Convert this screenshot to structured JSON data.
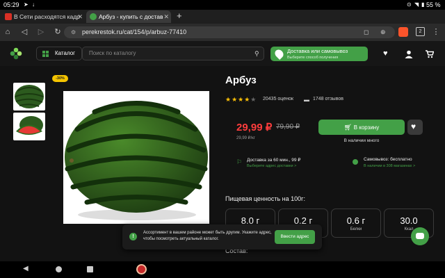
{
  "status_bar": {
    "time": "05:29",
    "battery": "55 %"
  },
  "tabs": [
    {
      "title": "В Сети расходятся кадр",
      "favicon_color": "#d93025"
    },
    {
      "title": "Арбуз - купить с достав",
      "favicon_color": "#43a047"
    }
  ],
  "browser": {
    "url": "perekrestok.ru/cat/154/p/arbuz-77410",
    "tab_count": "2"
  },
  "header": {
    "catalog_label": "Каталог",
    "search_placeholder": "Поиск по каталогу",
    "delivery_title": "Доставка или самовывоз",
    "delivery_subtitle": "Выберите способ получения"
  },
  "product": {
    "badge": "-30%",
    "title": "Арбуз",
    "rating_stars": 4,
    "ratings_count": "20435 оценок",
    "reviews_count": "1748 отзывов",
    "price": "29,99 ₽",
    "old_price": "79,90 ₽",
    "unit_price": "29,99 ₽/кг",
    "cart_button": "В корзину",
    "availability": "В наличии много",
    "delivery_info": "Доставка за 60 мин., 99 ₽",
    "delivery_link": "Выберите адрес доставки >",
    "pickup_info": "Самовывоз: бесплатно",
    "pickup_link": "В наличии в 308 магазинах >",
    "nutrition_title": "Пищевая ценность на 100г:",
    "nutrition": [
      {
        "value": "8.0 г",
        "label": ""
      },
      {
        "value": "0.2 г",
        "label": ""
      },
      {
        "value": "0.6 г",
        "label": "Белки"
      },
      {
        "value": "30.0",
        "label": "Ккал"
      }
    ],
    "composition_label": "Состав:"
  },
  "toast": {
    "text": "Ассортимент в вашем районе может быть другим. Укажите адрес, чтобы посмотреть актуальный каталог.",
    "button": "Ввести адрес"
  },
  "colors": {
    "accent": "#43a047",
    "price": "#ff3d3d",
    "background": "#121212"
  }
}
